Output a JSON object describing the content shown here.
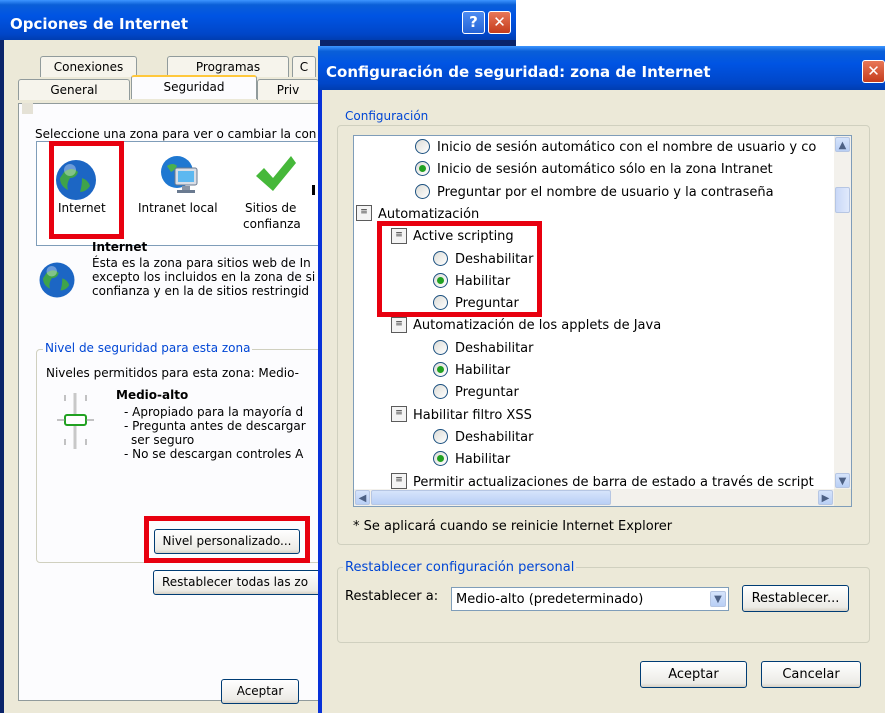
{
  "options_window": {
    "title": "Opciones de Internet",
    "help_glyph": "?",
    "close_glyph": "✕",
    "tabs_row1": [
      "Conexiones",
      "Programas",
      "C"
    ],
    "tabs_row2": [
      "General",
      "Seguridad",
      "Priv"
    ],
    "zone_prompt": "Seleccione una zona para ver o cambiar la con",
    "zones": [
      {
        "label": "Internet",
        "icon": "globe-icon"
      },
      {
        "label": "Intranet local",
        "icon": "network-computer-icon"
      },
      {
        "label": "Sitios de confianza",
        "icon": "checkmark-icon"
      }
    ],
    "zones_label3_line1": "Sitios de",
    "zones_label3_line2": "confianza",
    "zone_heading": "Internet",
    "zone_desc": [
      "Ésta es la zona para sitios web de In",
      "excepto los incluidos en la zona de si",
      "confianza y en la de sitios restringid"
    ],
    "security_group_label": "Nivel de seguridad para esta zona",
    "allowed_levels": "Niveles permitidos para esta zona: Medio-",
    "level_name": "Medio-alto",
    "level_desc": [
      "- Apropiado para la mayoría d",
      "- Pregunta antes de descargar",
      "ser seguro",
      "- No se descargan controles A"
    ],
    "custom_level_button": "Nivel personalizado...",
    "reset_all_button": "Restablecer todas las zo",
    "ok_button": "Aceptar"
  },
  "security_dialog": {
    "title": "Configuración de seguridad: zona de Internet",
    "close_glyph": "✕",
    "config_group_label": "Configuración",
    "settings": [
      {
        "kind": "radio",
        "indent": 1,
        "text": "Inicio de sesión automático con el nombre de usuario y co",
        "checked": false
      },
      {
        "kind": "radio",
        "indent": 1,
        "text": "Inicio de sesión automático sólo en la zona Intranet",
        "checked": true
      },
      {
        "kind": "radio",
        "indent": 1,
        "text": "Preguntar por el nombre de usuario y la contraseña",
        "checked": false
      },
      {
        "kind": "group",
        "indent": 0,
        "text": "Automatización"
      },
      {
        "kind": "group",
        "indent": 1,
        "text": "Active scripting"
      },
      {
        "kind": "radio",
        "indent": 2,
        "text": "Deshabilitar",
        "checked": false
      },
      {
        "kind": "radio",
        "indent": 2,
        "text": "Habilitar",
        "checked": true
      },
      {
        "kind": "radio",
        "indent": 2,
        "text": "Preguntar",
        "checked": false
      },
      {
        "kind": "group",
        "indent": 1,
        "text": "Automatización de los applets de Java"
      },
      {
        "kind": "radio",
        "indent": 2,
        "text": "Deshabilitar",
        "checked": false
      },
      {
        "kind": "radio",
        "indent": 2,
        "text": "Habilitar",
        "checked": true
      },
      {
        "kind": "radio",
        "indent": 2,
        "text": "Preguntar",
        "checked": false
      },
      {
        "kind": "group",
        "indent": 1,
        "text": "Habilitar filtro XSS"
      },
      {
        "kind": "radio",
        "indent": 2,
        "text": "Deshabilitar",
        "checked": false
      },
      {
        "kind": "radio",
        "indent": 2,
        "text": "Habilitar",
        "checked": true
      },
      {
        "kind": "group",
        "indent": 1,
        "text": "Permitir actualizaciones de barra de estado a través de script"
      }
    ],
    "restart_note": "* Se aplicará cuando se reinicie Internet Explorer",
    "reset_group_label": "Restablecer configuración personal",
    "reset_to_label": "Restablecer a:",
    "reset_select_value": "Medio-alto (predeterminado)",
    "reset_button": "Restablecer...",
    "ok_button": "Aceptar",
    "cancel_button": "Cancelar"
  },
  "colors": {
    "highlight_box": "#e8000f",
    "xp_title_blue": "#0054e3",
    "dialog_face": "#ece9d8",
    "group_label_blue": "#0046d5"
  }
}
